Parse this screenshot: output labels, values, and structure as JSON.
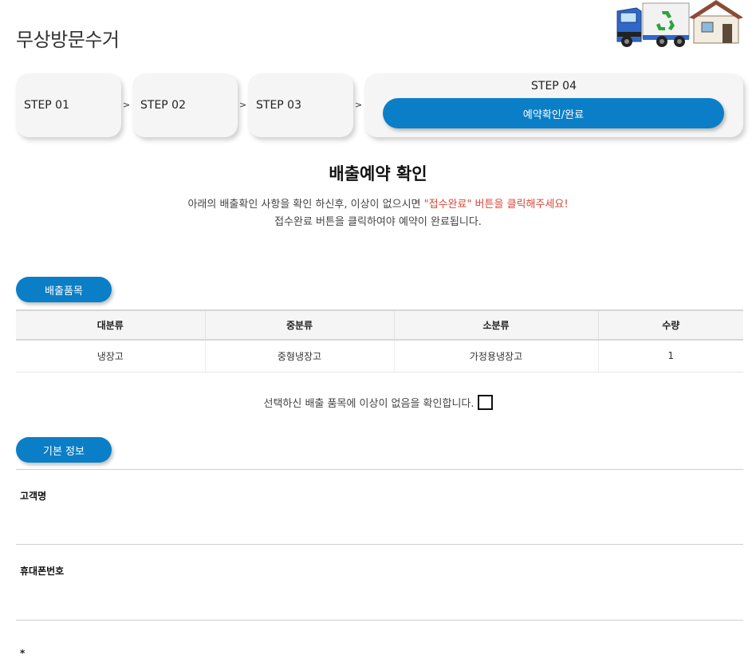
{
  "page": {
    "title": "무상방문수거"
  },
  "steps": {
    "step1": "STEP 01",
    "step2": "STEP 02",
    "step3": "STEP 03",
    "step4": {
      "title": "STEP 04",
      "button": "예약확인/완료"
    },
    "arrow": ">"
  },
  "confirm_section": {
    "heading": "배출예약 확인",
    "notice_line1_prefix": "아래의 배출확인 사항을 확인 하신후, 이상이 없으시면 ",
    "notice_line1_highlight": "\"접수완료\" 버튼을 클릭해주세요!",
    "notice_line2": "접수완료 버튼을 클릭하여야 예약이 완료됩니다."
  },
  "items_section": {
    "pill_label": "배출품목",
    "columns": [
      "대분류",
      "중분류",
      "소분류",
      "수량"
    ],
    "rows": [
      [
        "냉장고",
        "중형냉장고",
        "가정용냉장고",
        "1"
      ]
    ],
    "confirm_text": "선택하신 배출 품목에 이상이 없음을 확인합니다."
  },
  "basic_section": {
    "pill_label": "기본 정보",
    "fields": [
      "고객명",
      "휴대폰번호"
    ],
    "next_mark": "*"
  },
  "colors": {
    "accent": "#0a7fc7",
    "highlight": "#d9473a",
    "truck": "#2f68c9",
    "roof": "#8a4b38"
  },
  "icons": {
    "header": "truck-recycle-house-illustration"
  }
}
